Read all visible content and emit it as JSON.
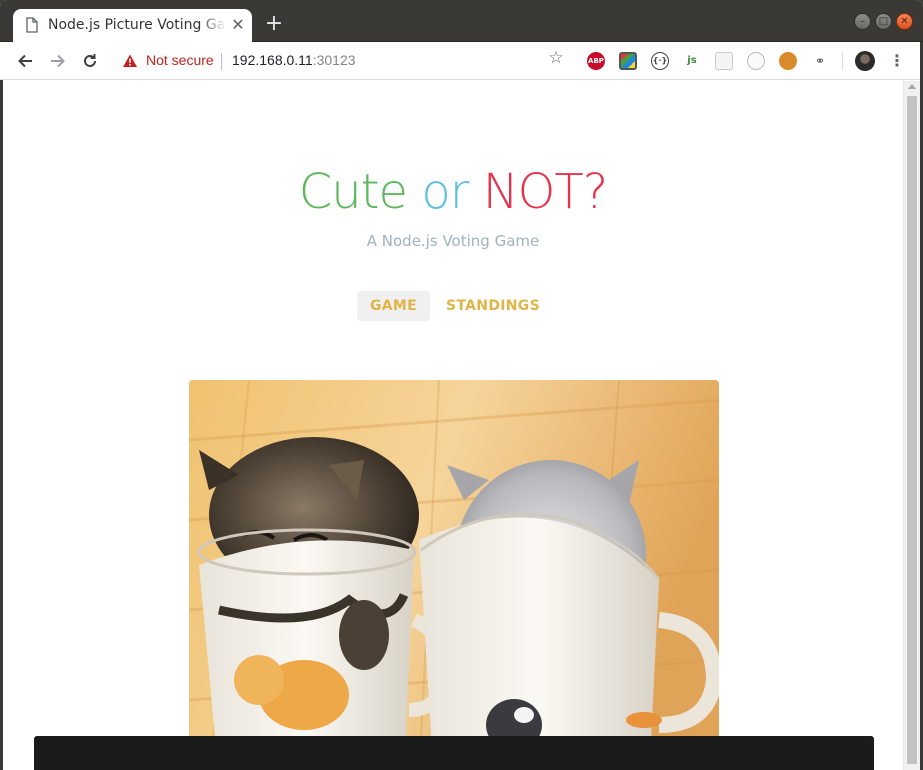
{
  "browser": {
    "tab_title": "Node.js Picture Voting Game",
    "tab_close": "✕",
    "new_tab": "+",
    "security_label": "Not secure",
    "url_host": "192.168.0.11",
    "url_port": ":30123",
    "extensions": [
      {
        "icon": "adblock-plus-icon",
        "label": "ABP"
      },
      {
        "icon": "color-picker-icon",
        "label": ""
      },
      {
        "icon": "json-viewer-icon",
        "label": "{·}"
      },
      {
        "icon": "nodejs-icon",
        "label": "js"
      },
      {
        "icon": "grid-extension-icon",
        "label": ""
      },
      {
        "icon": "circle-extension-icon",
        "label": ""
      },
      {
        "icon": "cookie-icon",
        "label": ""
      },
      {
        "icon": "link-extension-icon",
        "label": "⚭"
      }
    ]
  },
  "page": {
    "title_word1": "Cute",
    "title_word2": "or",
    "title_word3": "NOT?",
    "subtitle": "A Node.js Voting Game",
    "nav": {
      "game": "GAME",
      "standings": "STANDINGS"
    },
    "colors": {
      "cute": "#5cb85c",
      "or": "#5bc0de",
      "not": "#e8324c",
      "nav": "#e0b445",
      "subtitle": "#9fb3c0"
    }
  }
}
